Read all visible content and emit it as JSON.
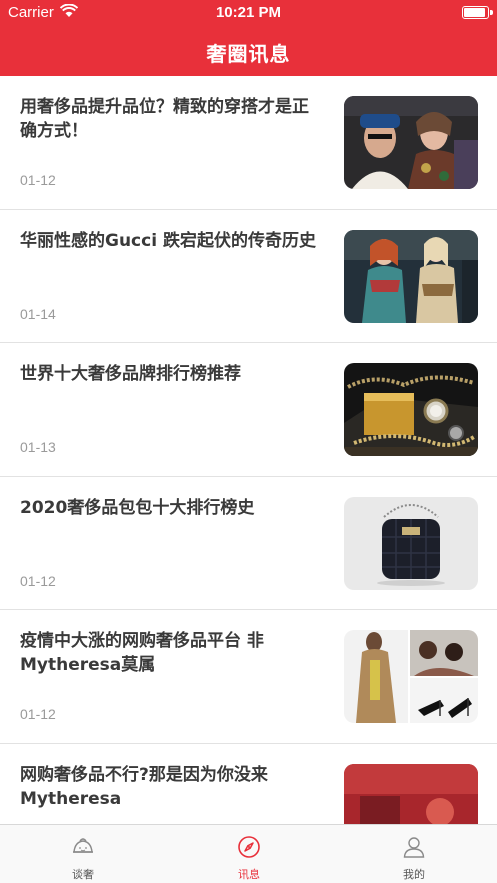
{
  "status_bar": {
    "carrier": "Carrier",
    "time": "10:21 PM",
    "battery_level": 0.95
  },
  "header": {
    "title": "奢圈讯息"
  },
  "articles": [
    {
      "title": "用奢侈品提升品位？精致的穿搭才是正确方式！",
      "date": "01-12"
    },
    {
      "title": "华丽性感的Gucci 跌宕起伏的传奇历史",
      "date": "01-14"
    },
    {
      "title": "世界十大奢侈品牌排行榜推荐",
      "date": "01-13"
    },
    {
      "title": "2020奢侈品包包十大排行榜史",
      "date": "01-12"
    },
    {
      "title": "疫情中大涨的网购奢侈品平台 非Mytheresa莫属",
      "date": "01-12"
    },
    {
      "title": "网购奢侈品不行?那是因为你没来Mytheresa",
      "date": ""
    }
  ],
  "tabbar": {
    "tabs": [
      {
        "label": "谈奢",
        "icon": "bun-icon"
      },
      {
        "label": "讯息",
        "icon": "compass-icon"
      },
      {
        "label": "我的",
        "icon": "person-icon"
      }
    ],
    "active_index": 1
  },
  "colors": {
    "brand": "#e8303a",
    "title_text": "#3a3a3a",
    "date_text": "#9a9a9a"
  }
}
